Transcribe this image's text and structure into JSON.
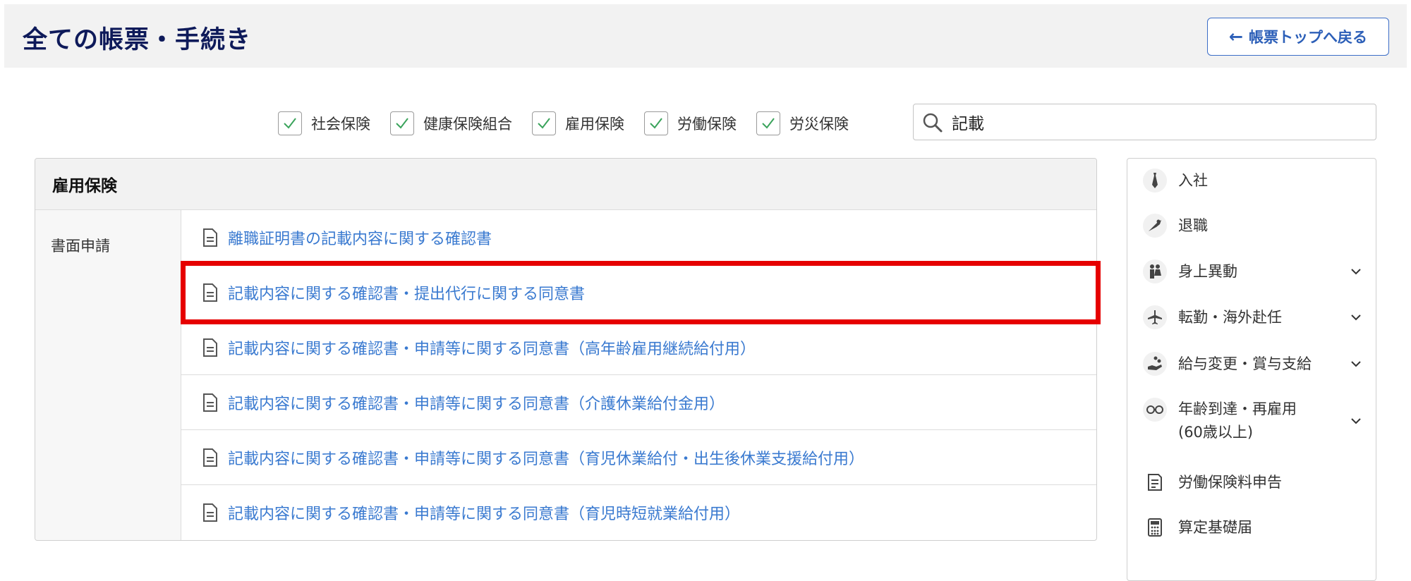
{
  "header": {
    "title": "全ての帳票・手続き",
    "back_button_label": "帳票トップへ戻る"
  },
  "filters": [
    {
      "label": "社会保険",
      "checked": true
    },
    {
      "label": "健康保険組合",
      "checked": true
    },
    {
      "label": "雇用保険",
      "checked": true
    },
    {
      "label": "労働保険",
      "checked": true
    },
    {
      "label": "労災保険",
      "checked": true
    }
  ],
  "search": {
    "value": "記載"
  },
  "main": {
    "section_title": "雇用保険",
    "category": "書面申請",
    "documents": [
      "離職証明書の記載内容に関する確認書",
      "記載内容に関する確認書・提出代行に関する同意書",
      "記載内容に関する確認書・申請等に関する同意書（高年齢雇用継続給付用）",
      "記載内容に関する確認書・申請等に関する同意書（介護休業給付金用）",
      "記載内容に関する確認書・申請等に関する同意書（育児休業給付・出生後休業支援給付用）",
      "記載内容に関する確認書・申請等に関する同意書（育児時短就業給付用）"
    ],
    "highlighted_index": 1
  },
  "sidebar": {
    "items": [
      {
        "label": "入社",
        "icon": "necktie-icon",
        "expandable": false
      },
      {
        "label": "退職",
        "icon": "bouquet-icon",
        "expandable": false
      },
      {
        "label": "身上異動",
        "icon": "couple-icon",
        "expandable": true
      },
      {
        "label": "転勤・海外赴任",
        "icon": "airplane-icon",
        "expandable": true
      },
      {
        "label": "給与変更・賞与支給",
        "icon": "coins-hand-icon",
        "expandable": true
      },
      {
        "label_line1": "年齢到達・再雇用",
        "label_line2": "(60歳以上)",
        "icon": "glasses-icon",
        "expandable": true
      },
      {
        "label": "労働保険料申告",
        "icon": "document-icon",
        "expandable": false
      },
      {
        "label": "算定基礎届",
        "icon": "calculator-icon",
        "expandable": false
      }
    ]
  },
  "colors": {
    "title": "#0e1a5a",
    "link": "#3a7ad0",
    "highlight": "#e60000",
    "checkmark": "#3aa35b",
    "accent_button": "#2c5fb8"
  }
}
